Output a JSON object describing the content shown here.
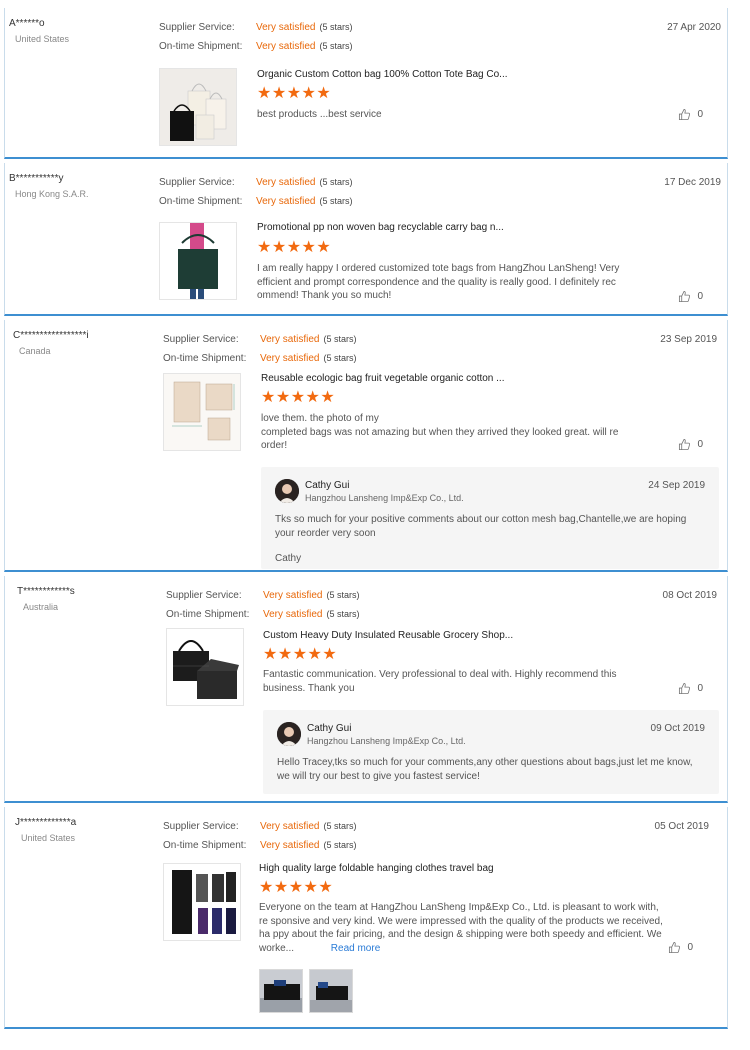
{
  "labels": {
    "supplier_service": "Supplier Service:",
    "ontime_shipment": "On-time Shipment:",
    "read_more": "Read more"
  },
  "reviews": [
    {
      "user": "A******o",
      "country": "United States",
      "supplier_rating": "Very satisfied",
      "supplier_stars": "(5 stars)",
      "shipment_rating": "Very satisfied",
      "shipment_stars": "(5 stars)",
      "date": "27 Apr 2020",
      "product_title": "Organic Custom Cotton bag 100% Cotton Tote Bag Co...",
      "stars": "★★★★★",
      "comment": "best products ...best service",
      "likes": "0"
    },
    {
      "user": "B***********y",
      "country": "Hong Kong S.A.R.",
      "supplier_rating": "Very satisfied",
      "supplier_stars": "(5 stars)",
      "shipment_rating": "Very satisfied",
      "shipment_stars": "(5 stars)",
      "date": "17 Dec 2019",
      "product_title": "Promotional pp non woven bag recyclable carry bag n...",
      "stars": "★★★★★",
      "comment": "I am really happy I ordered customized tote bags from HangZhou LanSheng! Very efficient and prompt correspondence and the quality is really good. I definitely rec ommend! Thank you so much!",
      "likes": "0"
    },
    {
      "user": "C*****************i",
      "country": "Canada",
      "supplier_rating": "Very satisfied",
      "supplier_stars": "(5 stars)",
      "shipment_rating": "Very satisfied",
      "shipment_stars": "(5 stars)",
      "date": "23 Sep 2019",
      "product_title": "Reusable ecologic bag fruit vegetable organic cotton ...",
      "stars": "★★★★★",
      "comment_line1": "love them. the photo of my",
      "comment_line2": "completed bags was not amazing but when they arrived they looked great. will re order!",
      "likes": "0",
      "reply": {
        "name": "Cathy Gui",
        "company": "Hangzhou Lansheng Imp&Exp Co., Ltd.",
        "date": "24 Sep 2019",
        "text": "Tks so much for your positive comments about our cotton mesh bag,Chantelle,we are hoping your reorder very soon",
        "sign": "Cathy"
      }
    },
    {
      "user": "T************s",
      "country": "Australia",
      "supplier_rating": "Very satisfied",
      "supplier_stars": "(5 stars)",
      "shipment_rating": "Very satisfied",
      "shipment_stars": "(5 stars)",
      "date": "08 Oct 2019",
      "product_title": "Custom Heavy Duty Insulated Reusable Grocery Shop...",
      "stars": "★★★★★",
      "comment": "Fantastic communication.  Very professional to deal with. Highly recommend this business. Thank you",
      "likes": "0",
      "reply": {
        "name": "Cathy Gui",
        "company": "Hangzhou Lansheng Imp&Exp Co., Ltd.",
        "date": "09 Oct 2019",
        "text": "Hello Tracey,tks so much for your comments,any other questions about bags,just let me know, we will try our best to give you fastest service!"
      }
    },
    {
      "user": "J*************a",
      "country": "United States",
      "supplier_rating": "Very satisfied",
      "supplier_stars": "(5 stars)",
      "shipment_rating": "Very satisfied",
      "shipment_stars": "(5 stars)",
      "date": "05 Oct 2019",
      "product_title": "High quality large foldable hanging clothes travel bag",
      "stars": "★★★★★",
      "comment": "Everyone on the team at HangZhou LanSheng Imp&Exp Co., Ltd. is pleasant to work with, re sponsive and very kind. We were impressed with the quality of the products we received, ha ppy about the fair pricing, and the design & shipping were both speedy and efficient. We worke...",
      "likes": "0"
    }
  ],
  "colors": {
    "accent_orange": "#e8680a",
    "star_orange": "#f26a10",
    "border_blue": "#3d8fd1",
    "link_blue": "#2a7bd6"
  }
}
